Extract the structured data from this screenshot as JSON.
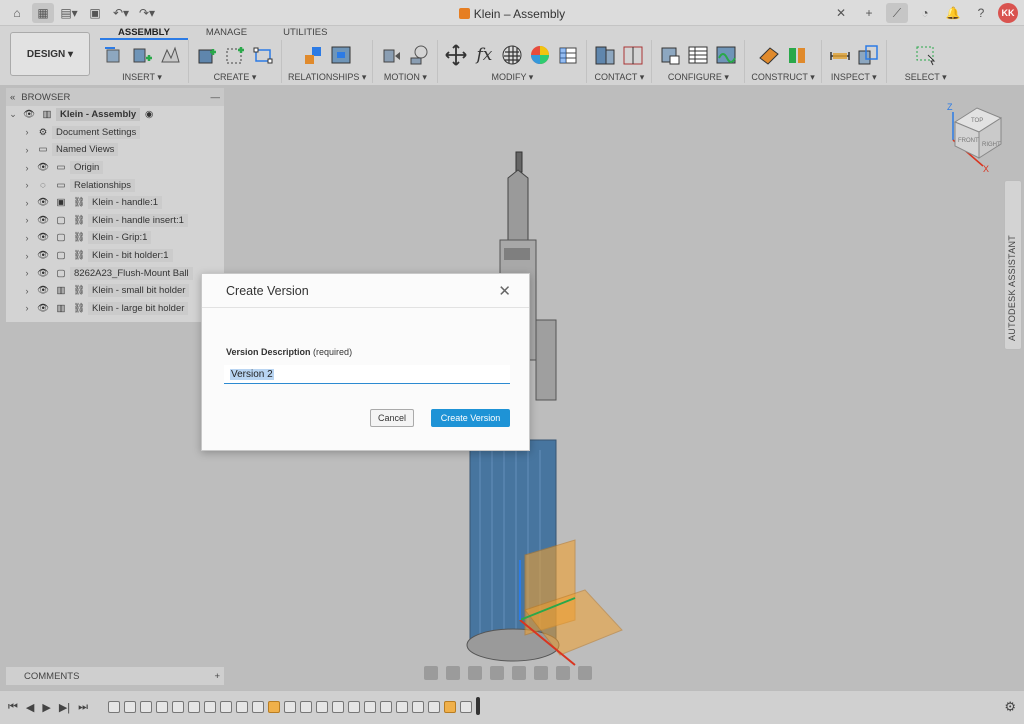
{
  "titlebar": {
    "title": "Klein – Assembly",
    "avatar_initials": "KK"
  },
  "ribbon": {
    "design_label": "DESIGN",
    "tabs": [
      "ASSEMBLY",
      "MANAGE",
      "UTILITIES"
    ],
    "groups": [
      {
        "label": "INSERT",
        "icons": [
          "insert-component-icon",
          "new-component-icon",
          "insert-derive-icon"
        ]
      },
      {
        "label": "CREATE",
        "icons": [
          "create-sketch-icon",
          "create-form-icon"
        ]
      },
      {
        "label": "RELATIONSHIPS",
        "icons": [
          "joint-icon",
          "as-built-joint-icon"
        ]
      },
      {
        "label": "MOTION",
        "icons": [
          "drive-joints-icon",
          "motion-link-icon"
        ]
      },
      {
        "label": "MODIFY",
        "icons": [
          "move-icon",
          "parameters-icon",
          "appearance-icon",
          "color-wheel-icon",
          "table-icon"
        ]
      },
      {
        "label": "CONTACT",
        "icons": [
          "contact-sets-icon",
          "enable-contact-icon"
        ]
      },
      {
        "label": "CONFIGURE",
        "icons": [
          "configure-icon",
          "config-table-icon",
          "config-theme-icon"
        ]
      },
      {
        "label": "CONSTRUCT",
        "icons": [
          "offset-plane-icon",
          "midplane-icon"
        ]
      },
      {
        "label": "INSPECT",
        "icons": [
          "measure-icon",
          "interference-icon"
        ]
      },
      {
        "label": "SELECT",
        "icons": [
          "select-icon"
        ]
      }
    ]
  },
  "browser": {
    "title": "BROWSER",
    "items": [
      {
        "label": "Klein - Assembly",
        "root": true
      },
      {
        "label": "Document Settings"
      },
      {
        "label": "Named Views"
      },
      {
        "label": "Origin"
      },
      {
        "label": "Relationships"
      },
      {
        "label": "Klein - handle:1"
      },
      {
        "label": "Klein - handle insert:1"
      },
      {
        "label": "Klein - Grip:1"
      },
      {
        "label": "Klein - bit holder:1"
      },
      {
        "label": "8262A23_Flush-Mount Ball"
      },
      {
        "label": "Klein - small bit holder"
      },
      {
        "label": "Klein - large bit holder"
      }
    ]
  },
  "comments": {
    "label": "COMMENTS"
  },
  "assistant": {
    "label": "AUTODESK ASSISTANT"
  },
  "viewcube": {
    "axis_z": "Z",
    "axis_x": "X",
    "faces": [
      "TOP",
      "FRONT",
      "RIGHT"
    ]
  },
  "dialog": {
    "title": "Create Version",
    "field_label": "Version Description",
    "field_hint": "(required)",
    "field_value": "Version 2",
    "cancel_label": "Cancel",
    "create_label": "Create Version"
  },
  "colors": {
    "accent": "#1e93d6",
    "handle_blue": "#3b6e9c",
    "plane_orange": "#f0a030",
    "background": "#bdbdbd"
  }
}
